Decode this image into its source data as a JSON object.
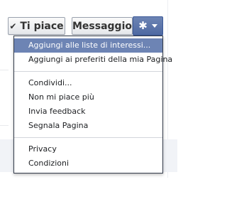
{
  "buttons": {
    "like_label": "Ti piace",
    "like_icon": "checkmark-icon",
    "message_label": "Messaggio",
    "gear_icon": "gear-icon",
    "caret_icon": "chevron-down-icon"
  },
  "menu": {
    "groups": [
      [
        "Aggiungi alle liste di interessi...",
        "Aggiungi ai preferiti della mia Pagina"
      ],
      [
        "Condividi...",
        "Non mi piace più",
        "Invia feedback",
        "Segnala Pagina"
      ],
      [
        "Privacy",
        "Condizioni"
      ]
    ],
    "highlighted_item": "Aggiungi alle liste di interessi..."
  },
  "colors": {
    "menu_highlight": "#6d84b4",
    "gear_button": "#4e69a2",
    "menu_border": "#333b4a"
  }
}
